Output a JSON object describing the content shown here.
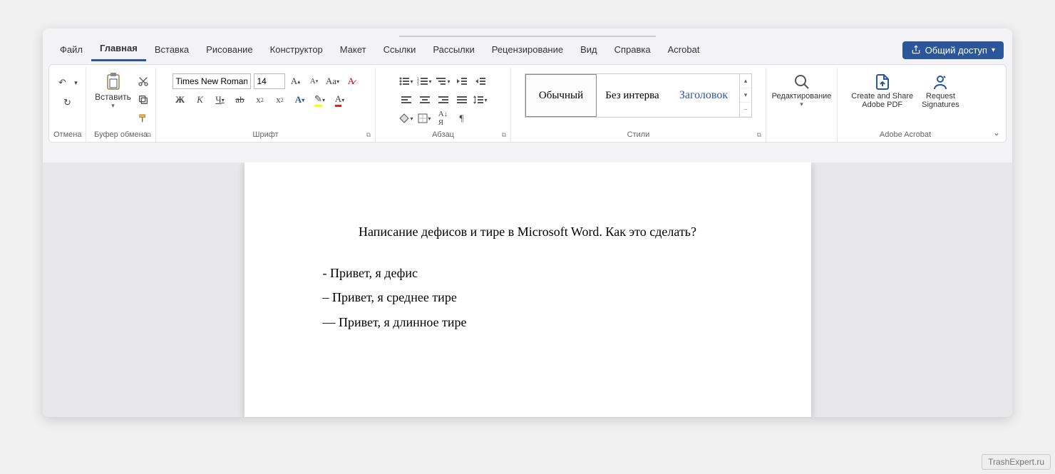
{
  "tabs": {
    "file": "Файл",
    "home": "Главная",
    "insert": "Вставка",
    "draw": "Рисование",
    "design": "Конструктор",
    "layout": "Макет",
    "references": "Ссылки",
    "mailings": "Рассылки",
    "review": "Рецензирование",
    "view": "Вид",
    "help": "Справка",
    "acrobat": "Acrobat"
  },
  "share_label": "Общий доступ",
  "groups": {
    "undo": "Отмена",
    "clipboard": "Буфер обмена",
    "paste": "Вставить",
    "font": "Шрифт",
    "paragraph": "Абзац",
    "styles": "Стили",
    "editing": "Редактирование",
    "acrobat": "Adobe Acrobat",
    "acrobat_btn1_l1": "Create and Share",
    "acrobat_btn1_l2": "Adobe PDF",
    "acrobat_btn2_l1": "Request",
    "acrobat_btn2_l2": "Signatures"
  },
  "font": {
    "name": "Times New Roman",
    "size": "14"
  },
  "styles": {
    "normal": "Обычный",
    "nospacing": "Без интерва",
    "heading1": "Заголовок"
  },
  "document": {
    "title": "Написание дефисов и тире в Microsoft Word. Как это сделать?",
    "line1": "- Привет, я дефис",
    "line2": "– Привет, я среднее тире",
    "line3": "— Привет, я длинное тире"
  },
  "watermark": "TrashExpert.ru"
}
